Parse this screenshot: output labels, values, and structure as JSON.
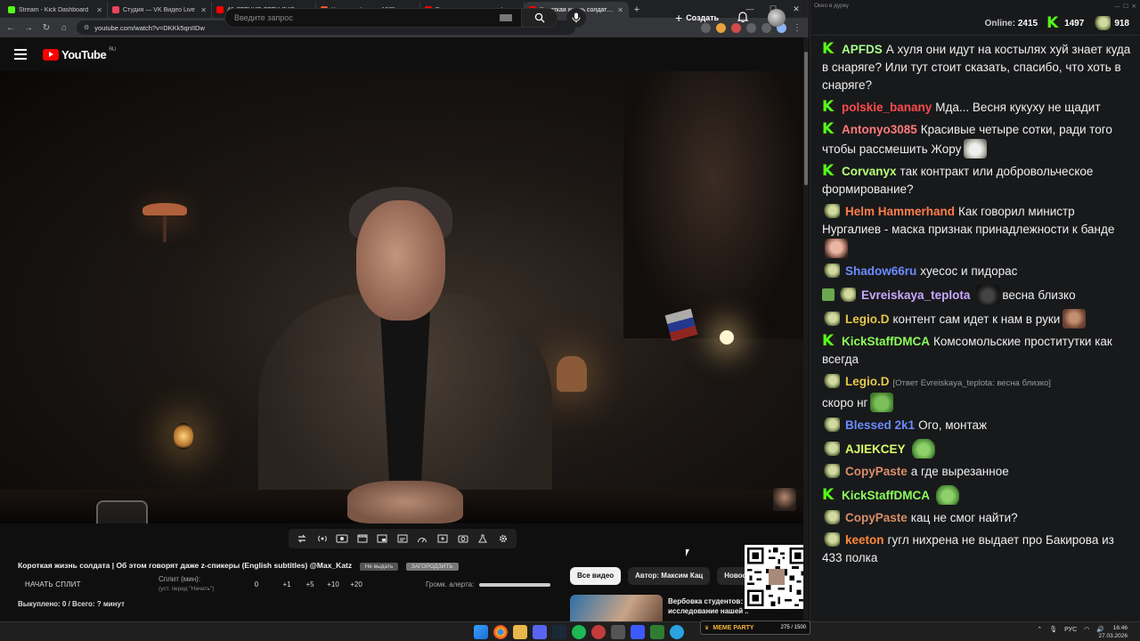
{
  "browser": {
    "tabs": [
      {
        "title": "Stream - Kick Dashboard",
        "color": "#53fc18"
      },
      {
        "title": "Студия — VK Видео Live",
        "color": "#e8455c"
      },
      {
        "title": "40-ЛЕТНИЕ ДЕТИ ДИСНЕЯ - YouTube",
        "color": "#ff0000"
      },
      {
        "title": "Челюсти фильм, 1975, дата выхода",
        "color": "#e85c2c"
      },
      {
        "title": "Рхи просит потерпеть (- YouTube",
        "color": "#ff0000"
      },
      {
        "title": "Короткая жизнь солдата | Об этом",
        "color": "#ff0000"
      }
    ],
    "new_tab": "+",
    "window_controls": [
      "—",
      "☐",
      "✕"
    ],
    "url": "youtube.com/watch?v=DKKk5qnIIDw"
  },
  "youtube": {
    "logo_text": "YouTube",
    "logo_region": "RU",
    "search_placeholder": "Введите запрос",
    "create_label": "Создать",
    "video_title": "Короткая жизнь солдата | Об этом говорят даже z-спикеры (English subtitles) @Max_Katz",
    "badge_1": "Не выдать",
    "badge_2": "ЗАГОРОДЗИТЬ",
    "start_split": "НАЧАТЬ СПЛИТ",
    "split_label": "Сплит (мин):",
    "split_hint": "(уст. перед \"Начать\")",
    "split_values": [
      "0",
      "+1",
      "+5",
      "+10",
      "+20"
    ],
    "alert_label": "Громк. алерта:",
    "alert_volume": 1.0,
    "bought": "Выкуплено: 0 / Всего: ? минут",
    "chips": [
      "Все видео",
      "Автор: Максим Кац",
      "Новост"
    ],
    "reco_title": "Вербовка студентов: исследование нашей ..."
  },
  "chat": {
    "window_title": "Окно в дурку",
    "online_label": "Online:",
    "online_count": "2415",
    "kick_count": "1497",
    "other_count": "918",
    "messages": [
      {
        "badge": "kick",
        "user": "APFDS",
        "color": "#a6ff8f",
        "text": "А хуля они идут на костылях хуй знает куда в снаряге? Или тут стоит сказать, спасибо, что хоть в снаряге?"
      },
      {
        "badge": "kick",
        "user": "polskie_banany",
        "color": "#ff4a4a",
        "text": "Мда... Весня кукуху не щадит"
      },
      {
        "badge": "kick",
        "user": "Antonyo3085",
        "color": "#ff7a7a",
        "text": "Красивые четыре сотки, ради того чтобы рассмешить Жору",
        "emote": "em-cat"
      },
      {
        "badge": "kick",
        "user": "Corvanyx",
        "color": "#b7ff7a",
        "text": "так контракт или добровольческое формирование?"
      },
      {
        "badge": "pepe",
        "user": "Helm Hammerhand",
        "color": "#ff7d4a",
        "text": "Как говорил министр Нургалиев - маска признак принадлежности к банде",
        "emote": "em-man"
      },
      {
        "badge": "pepe",
        "user": "Shadow66ru",
        "color": "#6a8cff",
        "text": "хуесос и пидорас"
      },
      {
        "badge": "sub",
        "user": "Evreiskaya_teplota",
        "color": "#c9a8ff",
        "text": "весна близко",
        "emote_before": "em-cat2"
      },
      {
        "badge": "pepe",
        "user": "Legio.D",
        "color": "#e4c84a",
        "text": "контент сам идет к нам в руки",
        "emote": "em-face"
      },
      {
        "badge": "kick",
        "user": "KickStaffDMCA",
        "color": "#8cff5a",
        "text": "Комсомольские проститутки как всегда"
      },
      {
        "badge": "pepe",
        "user": "Legio.D",
        "color": "#e4c84a",
        "reply": "[Ответ Evreiskaya_teplota: весна близко]",
        "text": "скоро нг",
        "emote": "em-frog"
      },
      {
        "badge": "pepe",
        "user": "Blessed 2k1",
        "color": "#6a8cff",
        "text": "Ого, монтаж"
      },
      {
        "badge": "pepe",
        "user": "AJIEKCEY",
        "color": "#d8ff6a",
        "text": "",
        "emote": "em-pepe"
      },
      {
        "badge": "pepe",
        "user": "CopyPaste",
        "color": "#d98f6a",
        "text": "а где вырезанное"
      },
      {
        "badge": "kick",
        "user": "KickStaffDMCA",
        "color": "#8cff5a",
        "text": "",
        "emote": "em-pepe"
      },
      {
        "badge": "pepe",
        "user": "CopyPaste",
        "color": "#d98f6a",
        "text": "кац не смог найти?"
      },
      {
        "badge": "pepe",
        "user": "keeton",
        "color": "#ff8a3a",
        "text": "гугл нихрена не выдает про Бакирова из 433 полка"
      }
    ]
  },
  "taskbar": {
    "lang": "РУС",
    "time": "16:46",
    "date": "27.03.2026",
    "meme_label": "MEME PARTY",
    "meme_count": "275 / 1500"
  }
}
